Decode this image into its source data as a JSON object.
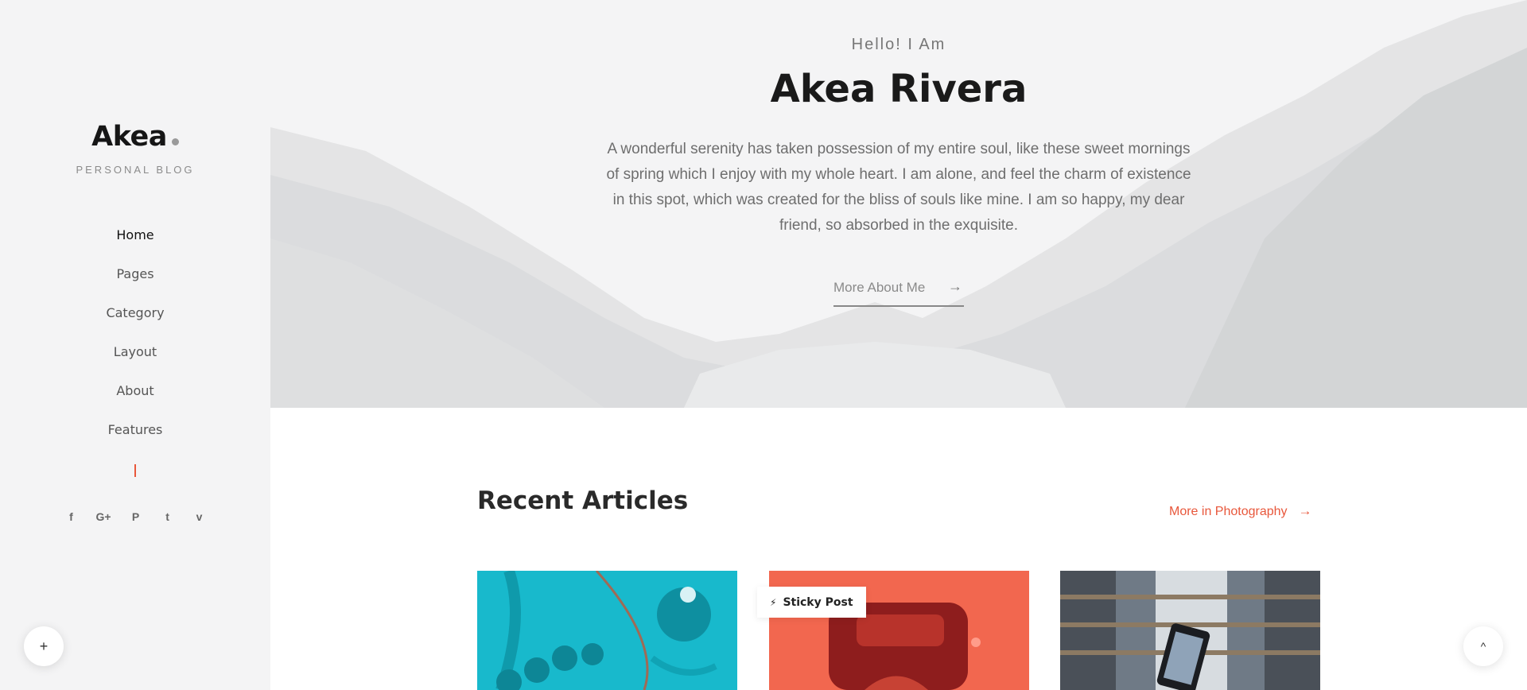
{
  "sidebar": {
    "logo": "Akea",
    "tagline": "PERSONAL BLOG",
    "nav": [
      {
        "label": "Home",
        "active": true
      },
      {
        "label": "Pages",
        "active": false
      },
      {
        "label": "Category",
        "active": false
      },
      {
        "label": "Layout",
        "active": false
      },
      {
        "label": "About",
        "active": false
      },
      {
        "label": "Features",
        "active": false
      }
    ],
    "social": [
      {
        "icon": "facebook-icon",
        "glyph": "f"
      },
      {
        "icon": "google-plus-icon",
        "glyph": "G+"
      },
      {
        "icon": "pinterest-icon",
        "glyph": "P"
      },
      {
        "icon": "twitter-icon",
        "glyph": "t"
      },
      {
        "icon": "vimeo-icon",
        "glyph": "v"
      }
    ]
  },
  "hero": {
    "greeting": "Hello! I Am",
    "name": "Akea Rivera",
    "text": "A wonderful serenity has taken possession of my entire soul, like these sweet mornings of spring which I enjoy with my whole heart. I am alone, and feel the charm of existence in this spot, which was created for the bliss of souls like mine. I am so happy, my dear friend, so absorbed in the exquisite.",
    "link_label": "More About Me"
  },
  "articles": {
    "title": "Recent Articles",
    "more_label": "More in Photography",
    "sticky_label": "Sticky Post",
    "cards": [
      {
        "theme": "teal",
        "color": "#18b9cc"
      },
      {
        "theme": "coral",
        "color": "#f2674f"
      },
      {
        "theme": "building",
        "color": "#7d8894"
      }
    ]
  },
  "colors": {
    "accent": "#e8573b",
    "sidebar_bg": "#f4f4f5"
  },
  "fab": {
    "plus": "+",
    "scroll_top": "^"
  }
}
